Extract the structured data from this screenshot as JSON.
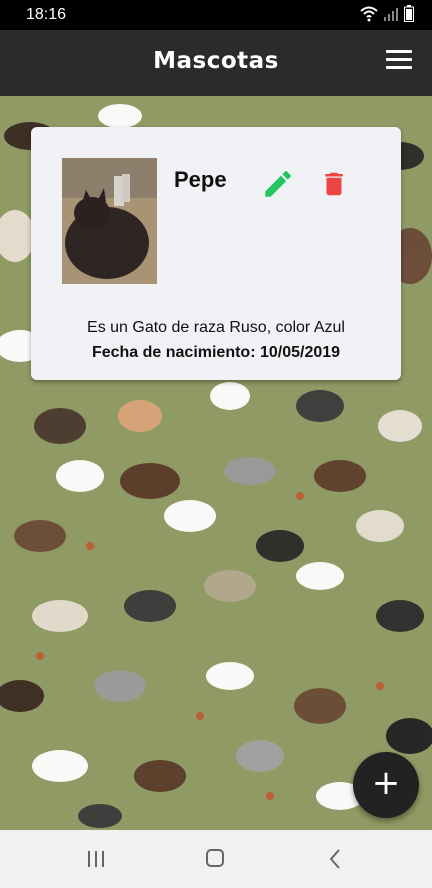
{
  "status_bar": {
    "time": "18:16"
  },
  "app_bar": {
    "title": "Mascotas"
  },
  "pet": {
    "name": "Pepe",
    "description": "Es un Gato de raza Ruso, color Azul",
    "birth": "Fecha de nacimiento: 10/05/2019"
  },
  "fab": {
    "label": "+"
  },
  "colors": {
    "app_bar": "#2b2b2b",
    "edit": "#22c55e",
    "delete": "#ef4444",
    "background_pattern": "#8f9a64",
    "fab": "#222222"
  },
  "icons": [
    "wifi-icon",
    "signal-icon",
    "battery-icon",
    "menu-icon",
    "edit-icon",
    "delete-icon",
    "add-icon",
    "recent-apps-icon",
    "home-icon",
    "back-icon"
  ]
}
